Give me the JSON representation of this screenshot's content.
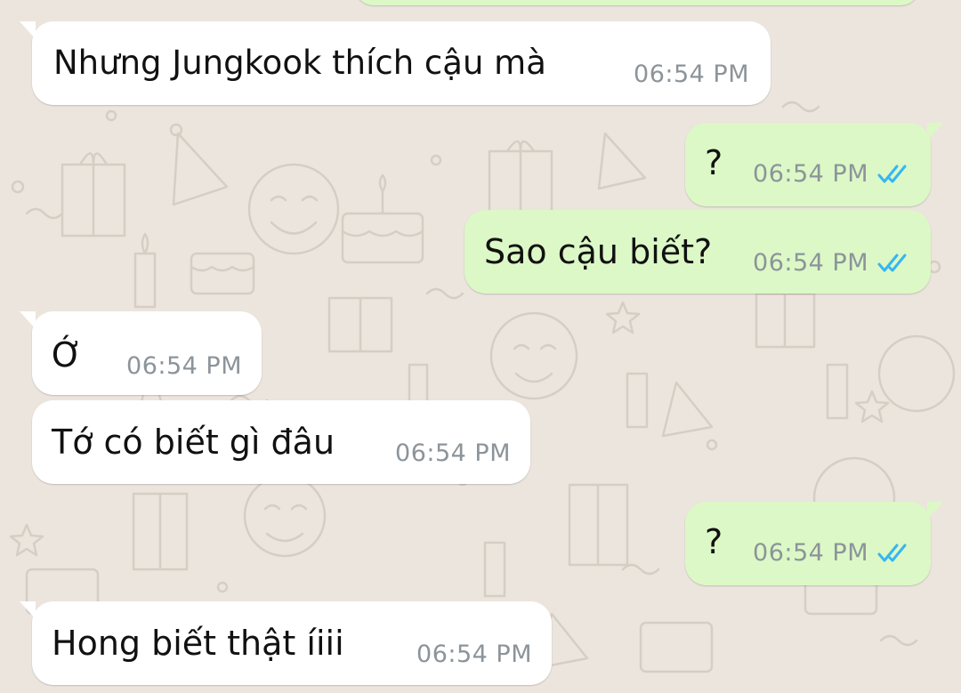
{
  "chat": {
    "messages": [
      {
        "direction": "in",
        "text": "Nhưng Jungkook thích cậu mà",
        "time": "06:54 PM"
      },
      {
        "direction": "out",
        "text": "?",
        "time": "06:54 PM",
        "status": "read",
        "status_icon": "double-check-icon"
      },
      {
        "direction": "out",
        "text": "Sao cậu biết?",
        "time": "06:54 PM",
        "status": "read",
        "status_icon": "double-check-icon"
      },
      {
        "direction": "in",
        "text": "Ớ",
        "time": "06:54 PM"
      },
      {
        "direction": "in",
        "text": "Tớ có biết gì đâu",
        "time": "06:54 PM"
      },
      {
        "direction": "out",
        "text": "?",
        "time": "06:54 PM",
        "status": "read",
        "status_icon": "double-check-icon"
      },
      {
        "direction": "in",
        "text": "Hong biết thật íiii",
        "time": "06:54 PM"
      }
    ]
  },
  "colors": {
    "background": "#ece5dd",
    "incoming_bubble": "#ffffff",
    "outgoing_bubble": "#dcf8c6",
    "timestamp": "#8c949a",
    "read_ticks": "#34b7f1"
  }
}
